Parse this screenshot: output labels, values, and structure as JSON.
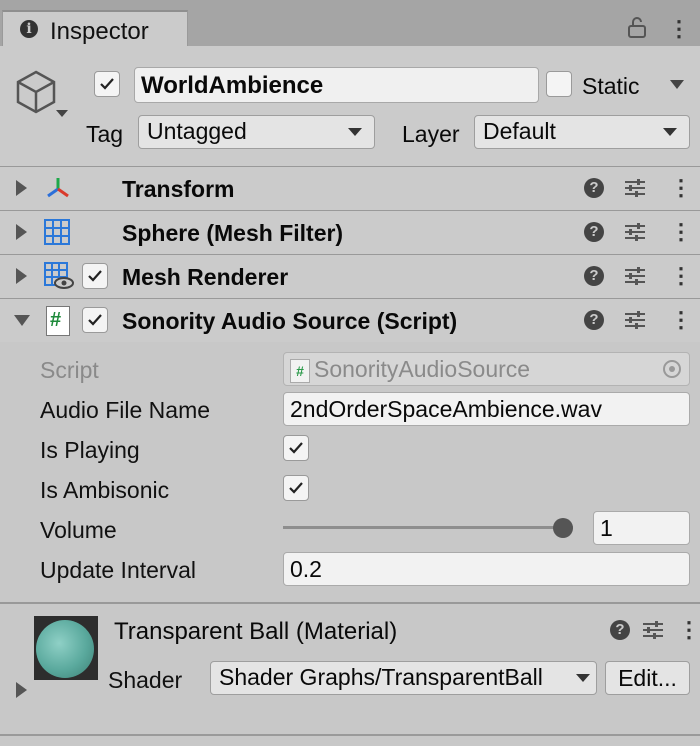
{
  "window": {
    "tab_title": "Inspector"
  },
  "gameobject": {
    "name": "WorldAmbience",
    "active": true,
    "static_label": "Static",
    "tag_label": "Tag",
    "tag_value": "Untagged",
    "layer_label": "Layer",
    "layer_value": "Default"
  },
  "components": [
    {
      "title": "Transform",
      "icon": "transform-axes-icon",
      "expanded": false
    },
    {
      "title": "Sphere (Mesh Filter)",
      "icon": "mesh-filter-icon",
      "expanded": false
    },
    {
      "title": "Mesh Renderer",
      "icon": "mesh-renderer-icon",
      "enabled": true,
      "expanded": false
    },
    {
      "title": "Sonority Audio Source (Script)",
      "icon": "csharp-script-icon",
      "enabled": true,
      "expanded": true
    }
  ],
  "script_props": {
    "script_label": "Script",
    "script_value": "SonorityAudioSource",
    "audio_file_label": "Audio File Name",
    "audio_file_value": "2ndOrderSpaceAmbience.wav",
    "is_playing_label": "Is Playing",
    "is_playing": true,
    "is_ambisonic_label": "Is Ambisonic",
    "is_ambisonic": true,
    "volume_label": "Volume",
    "volume_value": "1",
    "volume_fraction": 1.0,
    "update_interval_label": "Update Interval",
    "update_interval_value": "0.2"
  },
  "material": {
    "title": "Transparent Ball (Material)",
    "shader_label": "Shader",
    "shader_value": "Shader Graphs/TransparentBall",
    "edit_button": "Edit..."
  },
  "icons": {
    "help": "?",
    "hash": "#"
  }
}
